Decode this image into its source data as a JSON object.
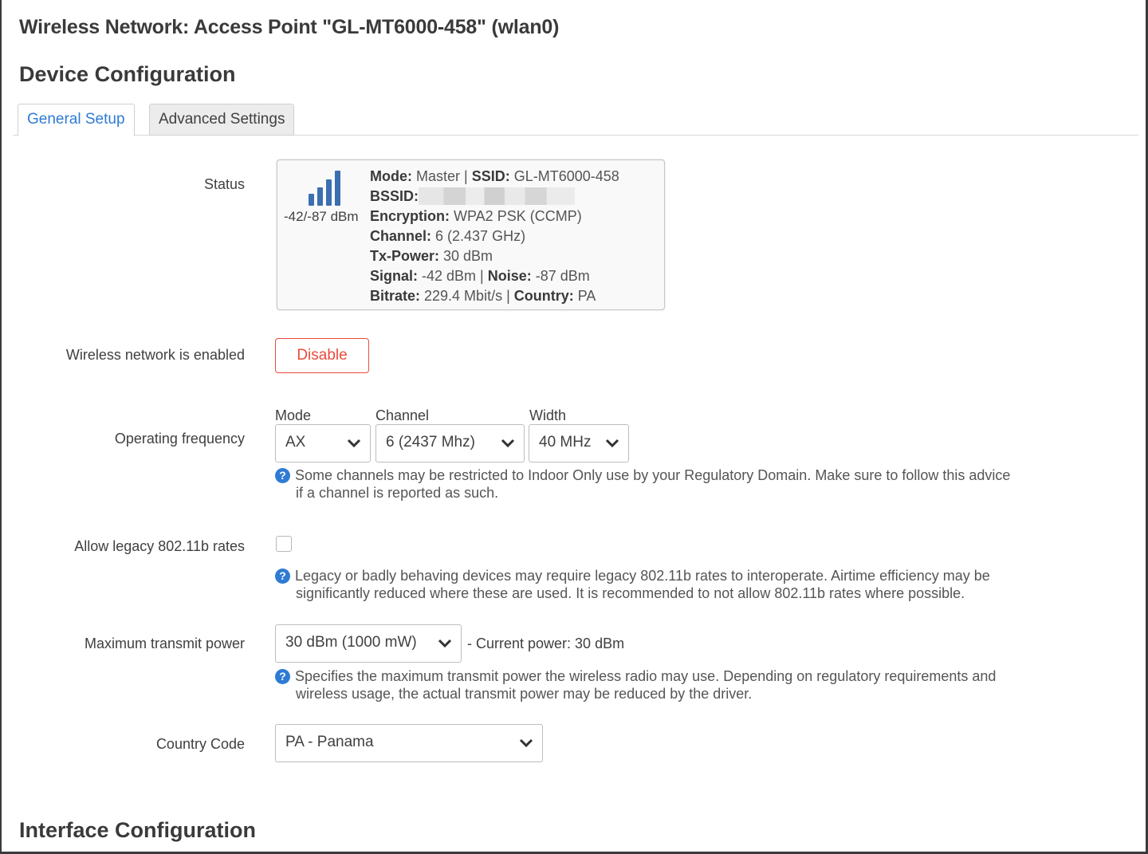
{
  "page": {
    "title": "Wireless Network: Access Point \"GL-MT6000-458\" (wlan0)",
    "device_section": "Device Configuration",
    "interface_section": "Interface Configuration"
  },
  "tabs": [
    {
      "label": "General Setup",
      "active": true
    },
    {
      "label": "Advanced Settings",
      "active": false
    }
  ],
  "status": {
    "label": "Status",
    "signal_text": "-42/-87 dBm",
    "signal_bars_filled": 4,
    "mode_key": "Mode:",
    "mode_val": " Master | ",
    "ssid_key": "SSID:",
    "ssid_val": " GL-MT6000-458",
    "bssid_key": "BSSID:",
    "encryption_key": "Encryption:",
    "encryption_val": " WPA2 PSK (CCMP)",
    "channel_key": "Channel:",
    "channel_val": " 6 (2.437 GHz)",
    "txpower_key": "Tx-Power:",
    "txpower_val": " 30 dBm",
    "signal_key": "Signal:",
    "signal_val": " -42 dBm | ",
    "noise_key": "Noise:",
    "noise_val": " -87 dBm",
    "bitrate_key": "Bitrate:",
    "bitrate_val": " 229.4 Mbit/s | ",
    "country_key": "Country:",
    "country_val": " PA"
  },
  "enabled": {
    "label": "Wireless network is enabled",
    "button": "Disable"
  },
  "frequency": {
    "label": "Operating frequency",
    "mode_label": "Mode",
    "mode_value": "AX",
    "channel_label": "Channel",
    "channel_value": "6 (2437 Mhz)",
    "width_label": "Width",
    "width_value": "40 MHz",
    "hint_line1": "Some channels may be restricted to Indoor Only use by your Regulatory Domain. Make sure to follow this advice",
    "hint_line2": "if a channel is reported as such."
  },
  "legacy": {
    "label": "Allow legacy 802.11b rates",
    "hint_line1": "Legacy or badly behaving devices may require legacy 802.11b rates to interoperate. Airtime efficiency may be",
    "hint_line2": "significantly reduced where these are used. It is recommended to not allow 802.11b rates where possible."
  },
  "txpower": {
    "label": "Maximum transmit power",
    "value": "30 dBm (1000 mW)",
    "current": "- Current power: 30 dBm",
    "hint_line1": "Specifies the maximum transmit power the wireless radio may use. Depending on regulatory requirements and",
    "hint_line2": "wireless usage, the actual transmit power may be reduced by the driver."
  },
  "country": {
    "label": "Country Code",
    "value": "PA - Panama"
  },
  "colors": {
    "accent": "#2f7bd3",
    "danger": "#e74c3c",
    "signal_bar": "#3b6fb0"
  },
  "icons": {
    "signal": "signal-bars-icon",
    "help": "help-circle-icon",
    "dropdown": "chevron-down-icon"
  }
}
